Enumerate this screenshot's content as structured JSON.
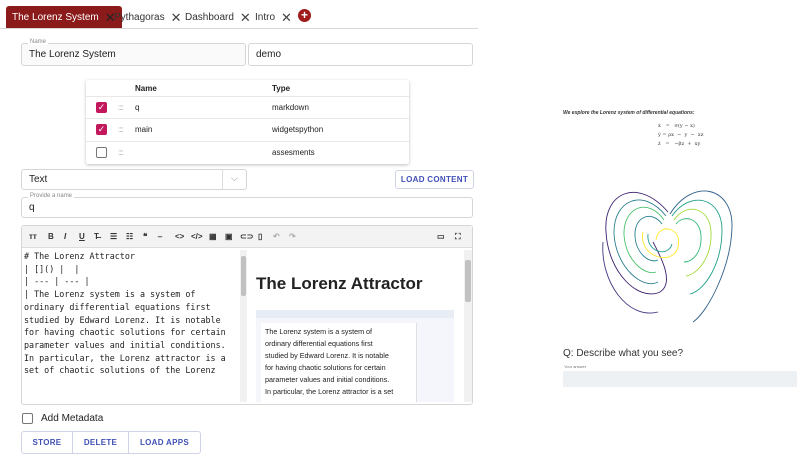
{
  "tabs": [
    {
      "label": "The Lorenz System",
      "active": true
    },
    {
      "label": "Pythagoras",
      "active": false
    },
    {
      "label": "Dashboard",
      "active": false
    },
    {
      "label": "Intro",
      "active": false
    }
  ],
  "add_tab_glyph": "+",
  "close_glyph": "✕",
  "name_field": {
    "label": "Name",
    "value": "The Lorenz System"
  },
  "demo_field": {
    "value": "demo"
  },
  "table": {
    "headers": {
      "name": "Name",
      "type": "Type"
    },
    "rows": [
      {
        "name": "q",
        "type": "markdown",
        "checked": true
      },
      {
        "name": "main",
        "type": "widgetspython",
        "checked": true
      },
      {
        "name": "",
        "type": "assesments",
        "checked": false
      }
    ],
    "drag_glyph": "::::"
  },
  "content_select": {
    "value": "Text"
  },
  "load_content_label": "LOAD CONTENT",
  "provide_name": {
    "label": "Provide a name",
    "value": "q"
  },
  "toolbar_icons": [
    "heading-icon",
    "bold-icon",
    "italic-icon",
    "underline-icon",
    "strikethrough-icon",
    "list-icon",
    "ordered-list-icon",
    "quote-icon",
    "horizontal-rule-icon",
    "code-icon",
    "code-block-icon",
    "table-icon",
    "image-icon",
    "link-icon",
    "clipboard-icon",
    "undo-icon",
    "redo-icon"
  ],
  "toolbar_glyphs": [
    "ᴛᴛ",
    "B",
    "I",
    "U",
    "T̶",
    "☰",
    "☷",
    "❝",
    "⎯",
    "<>",
    "</>",
    "▦",
    "▣",
    "⊂⊃",
    "▯",
    "↶",
    "↷"
  ],
  "toolbar_right": [
    "▭",
    "⛶"
  ],
  "editor_lines": [
    "# The Lorenz Attractor",
    "",
    "| []() |  |",
    "| --- | --- |",
    "| The Lorenz system is a system of",
    "ordinary differential equations first",
    "studied by Edward Lorenz. It is notable",
    "for having chaotic solutions for certain",
    "parameter values and initial conditions.",
    "In particular, the Lorenz attractor is a",
    "set of chaotic solutions of the Lorenz"
  ],
  "preview": {
    "title": "The Lorenz Attractor",
    "text": [
      "The Lorenz system is a system of",
      "ordinary differential equations first",
      "studied by Edward Lorenz. It is notable",
      "for having chaotic solutions for certain",
      "parameter values and initial conditions.",
      "In particular, the Lorenz attractor is a set"
    ]
  },
  "add_metadata_label": "Add Metadata",
  "bottom_buttons": {
    "store": "STORE",
    "delete": "DELETE",
    "load_apps": "LOAD APPS"
  },
  "right_panel": {
    "intro": "We explore the Lorenz system of differential equations:",
    "eq1": "ẋ   =   σ(y − x)",
    "eq2": "ẏ = ρx  −  y  −  xz",
    "eq3": "ż   =   −βz  +  xy",
    "question": "Q: Describe what you see?",
    "answer_label": "Your answer"
  },
  "colors": {
    "accent": "#8b1a1a",
    "checkbox": "#c2185b",
    "button_text": "#3f51b5"
  }
}
